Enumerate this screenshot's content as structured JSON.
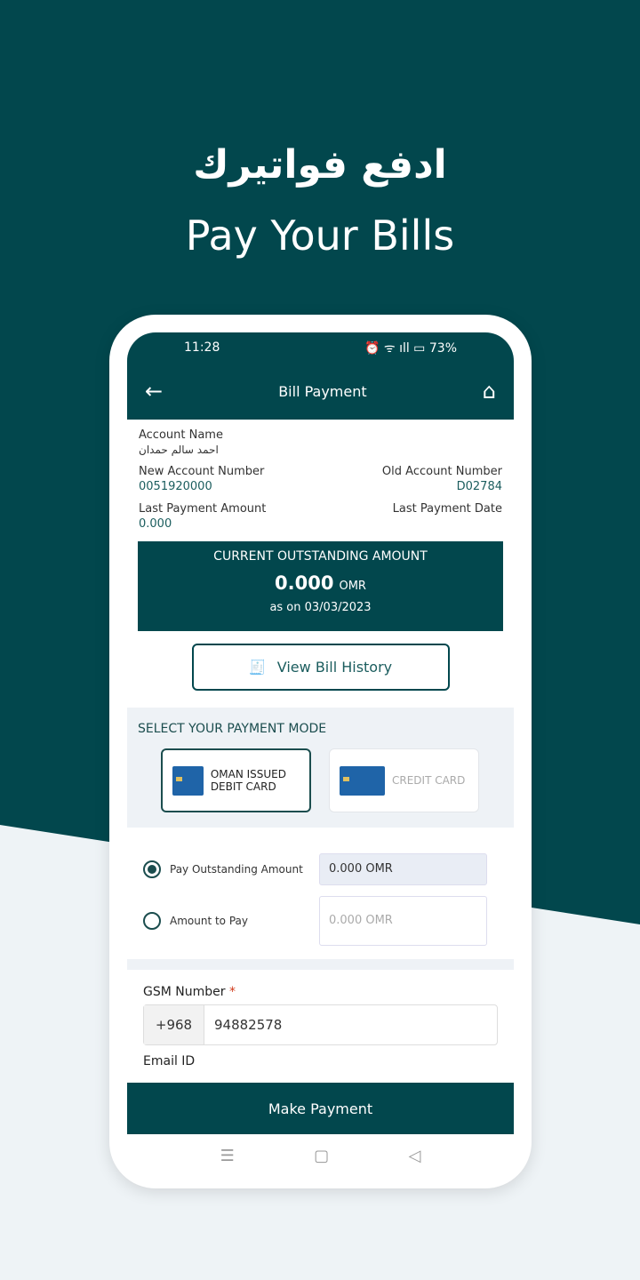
{
  "hero": {
    "title_ar": "ادفع فواتيرك",
    "title_en": "Pay Your Bills"
  },
  "status_bar": {
    "time": "11:28",
    "battery": "73%"
  },
  "app_bar": {
    "title": "Bill Payment",
    "back_icon": "arrow-left-icon",
    "home_icon": "home-icon"
  },
  "account": {
    "name_label": "Account Name",
    "name_value": "احمد سالم حمدان",
    "new_acc_label": "New Account Number",
    "new_acc_value": "0051920000",
    "old_acc_label": "Old Account Number",
    "old_acc_value": "D02784",
    "last_amt_label": "Last Payment Amount",
    "last_amt_value": "0.000",
    "last_date_label": "Last Payment Date"
  },
  "outstanding": {
    "title": "CURRENT OUTSTANDING AMOUNT",
    "amount": "0.000",
    "currency": "OMR",
    "as_on": "as on 03/03/2023"
  },
  "history_button": "View Bill History",
  "payment_mode": {
    "title": "SELECT YOUR PAYMENT MODE",
    "options": [
      {
        "label": "OMAN ISSUED DEBIT CARD",
        "selected": true
      },
      {
        "label": "CREDIT CARD",
        "selected": false
      }
    ]
  },
  "amount": {
    "outstanding_label": "Pay Outstanding Amount",
    "outstanding_value": "0.000 OMR",
    "custom_label": "Amount to Pay",
    "custom_placeholder": "0.000 OMR"
  },
  "gsm": {
    "label": "GSM Number",
    "required": "*",
    "code": "+968",
    "value": "94882578"
  },
  "email": {
    "label": "Email ID"
  },
  "make_payment": "Make Payment",
  "nav": {
    "menu": "☰",
    "home": "▢",
    "back": "◁"
  },
  "colors": {
    "primary": "#02474d",
    "accent": "#1b5d5e"
  }
}
